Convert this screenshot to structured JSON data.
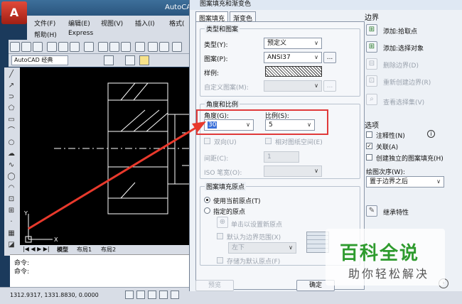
{
  "cad": {
    "title": "AutoCAD",
    "menu": [
      "文件(F)",
      "编辑(E)",
      "视图(V)",
      "插入(I)",
      "格式(",
      "帮助(H)",
      "Express"
    ],
    "workspace": "AutoCAD 经典",
    "tabs": [
      "模型",
      "布局1",
      "布局2"
    ],
    "command_lines": [
      "命令:",
      "命令:"
    ],
    "coords": "1312.9317,  1331.8830,  0.0000"
  },
  "dialog": {
    "title": "图案填充和渐变色",
    "tabs": [
      "图案填充",
      "渐变色"
    ],
    "type_pattern": {
      "group": "类型和图案",
      "type_label": "类型(Y):",
      "type_value": "预定义",
      "pattern_label": "图案(P):",
      "pattern_value": "ANSI37",
      "pattern_more": "...",
      "sample_label": "样例:",
      "custom_label": "自定义图案(M):",
      "custom_more": "..."
    },
    "angle_scale": {
      "group": "角度和比例",
      "angle_label": "角度(G):",
      "angle_value": "30",
      "scale_label": "比例(S):",
      "scale_value": "5",
      "double_label": "双向(U)",
      "relative_label": "相对图纸空间(E)",
      "spacing_label": "间距(C):",
      "spacing_value": "1",
      "iso_label": "ISO 笔宽(O):"
    },
    "origin": {
      "group": "图案填充原点",
      "use_current": "使用当前原点(T)",
      "specified": "指定的原点",
      "click_set": "单击以设置新原点",
      "default_boundary": "默认为边界范围(X)",
      "position_value": "左下",
      "store_default": "存储为默认原点(F)"
    },
    "boundary": {
      "group": "边界",
      "add_pick": "添加:拾取点",
      "add_select": "添加:选择对象",
      "remove": "删除边界(D)",
      "recreate": "重新创建边界(R)",
      "view_sel": "查看选择集(V)"
    },
    "options": {
      "group": "选项",
      "annotative": "注释性(N)",
      "associative": "关联(A)",
      "independent": "创建独立的图案填充(H)",
      "draw_order_label": "绘图次序(W):",
      "draw_order_value": "置于边界之后"
    },
    "inherit": "继承特性",
    "preview": "预览",
    "ok": "确定"
  },
  "watermark": {
    "title": "百科全说",
    "subtitle": "助你轻松解决"
  },
  "colors": {
    "highlight": "#e03a3a",
    "arrow": "#e8392c",
    "watermark_green": "#2e9b2e"
  }
}
